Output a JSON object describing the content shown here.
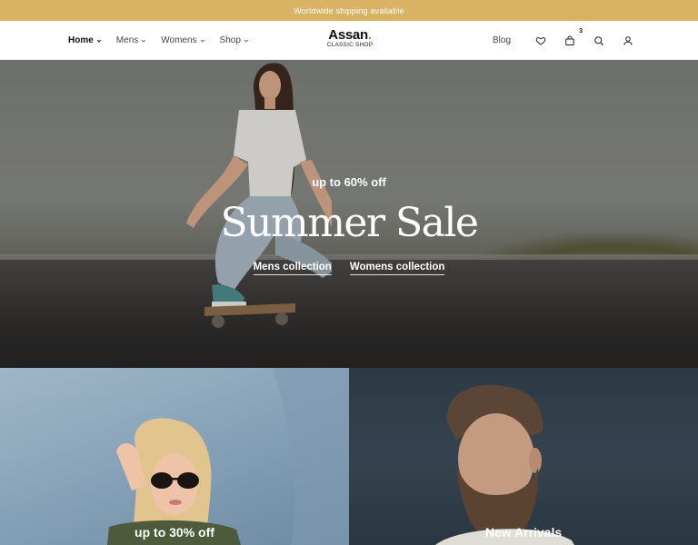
{
  "announcement": {
    "text": "Worldwide shipping available"
  },
  "nav": {
    "items": [
      {
        "label": "Home"
      },
      {
        "label": "Mens"
      },
      {
        "label": "Womens"
      },
      {
        "label": "Shop"
      }
    ]
  },
  "logo": {
    "title": "Assan",
    "subtitle": "CLASSIC SHOP"
  },
  "header_right": {
    "blog_label": "Blog",
    "cart_count": "3"
  },
  "hero": {
    "kicker": "up to 60% off",
    "title": "Summer Sale",
    "links": [
      {
        "label": "Mens collection"
      },
      {
        "label": "Womens collection"
      }
    ]
  },
  "tiles": [
    {
      "label": "up to 30% off"
    },
    {
      "label": "New Arrivals"
    }
  ],
  "colors": {
    "accent": "#d9b264",
    "logo_dot": "#d97a1f"
  }
}
